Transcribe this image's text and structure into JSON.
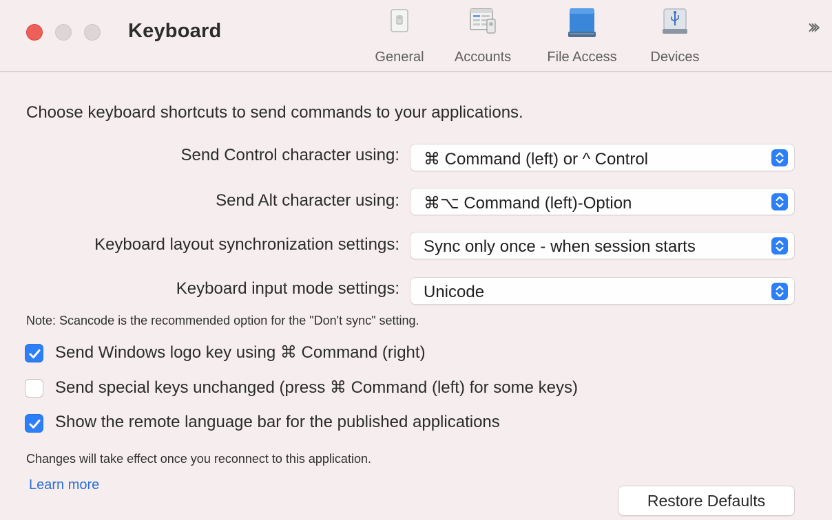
{
  "window": {
    "title": "Keyboard",
    "controls": [
      "close",
      "minimize",
      "maximize"
    ]
  },
  "toolbar": {
    "items": [
      {
        "label": "General",
        "icon": "general-switch-icon"
      },
      {
        "label": "Accounts",
        "icon": "accounts-window-icon"
      },
      {
        "label": "File Access",
        "icon": "file-access-drive-icon"
      },
      {
        "label": "Devices",
        "icon": "devices-usb-icon"
      }
    ],
    "overflow_icon": "chevron-double-right-icon"
  },
  "main": {
    "intro": "Choose keyboard shortcuts to send commands to your applications.",
    "settings": [
      {
        "label": "Send Control character using:",
        "value": "⌘ Command (left) or ^ Control"
      },
      {
        "label": "Send Alt character using:",
        "value": "⌘⌥ Command (left)-Option"
      },
      {
        "label": "Keyboard layout synchronization settings:",
        "value": "Sync only once - when session starts"
      },
      {
        "label": "Keyboard input mode settings:",
        "value": "Unicode"
      }
    ],
    "note": "Note: Scancode is the recommended option for the \"Don't sync\" setting.",
    "checkboxes": [
      {
        "label": "Send Windows logo key using ⌘ Command (right)",
        "checked": true
      },
      {
        "label": "Send special keys unchanged (press ⌘ Command (left) for some keys)",
        "checked": false
      },
      {
        "label": "Show the remote language bar for the published applications",
        "checked": true
      }
    ],
    "changes_note": "Changes will take effect once you reconnect to this application.",
    "learn_more": "Learn more",
    "restore_button": "Restore Defaults"
  },
  "colors": {
    "accent": "#2d7ff7",
    "close": "#ed5f59",
    "link": "#2c6fd6",
    "background": "#f6eeee"
  }
}
